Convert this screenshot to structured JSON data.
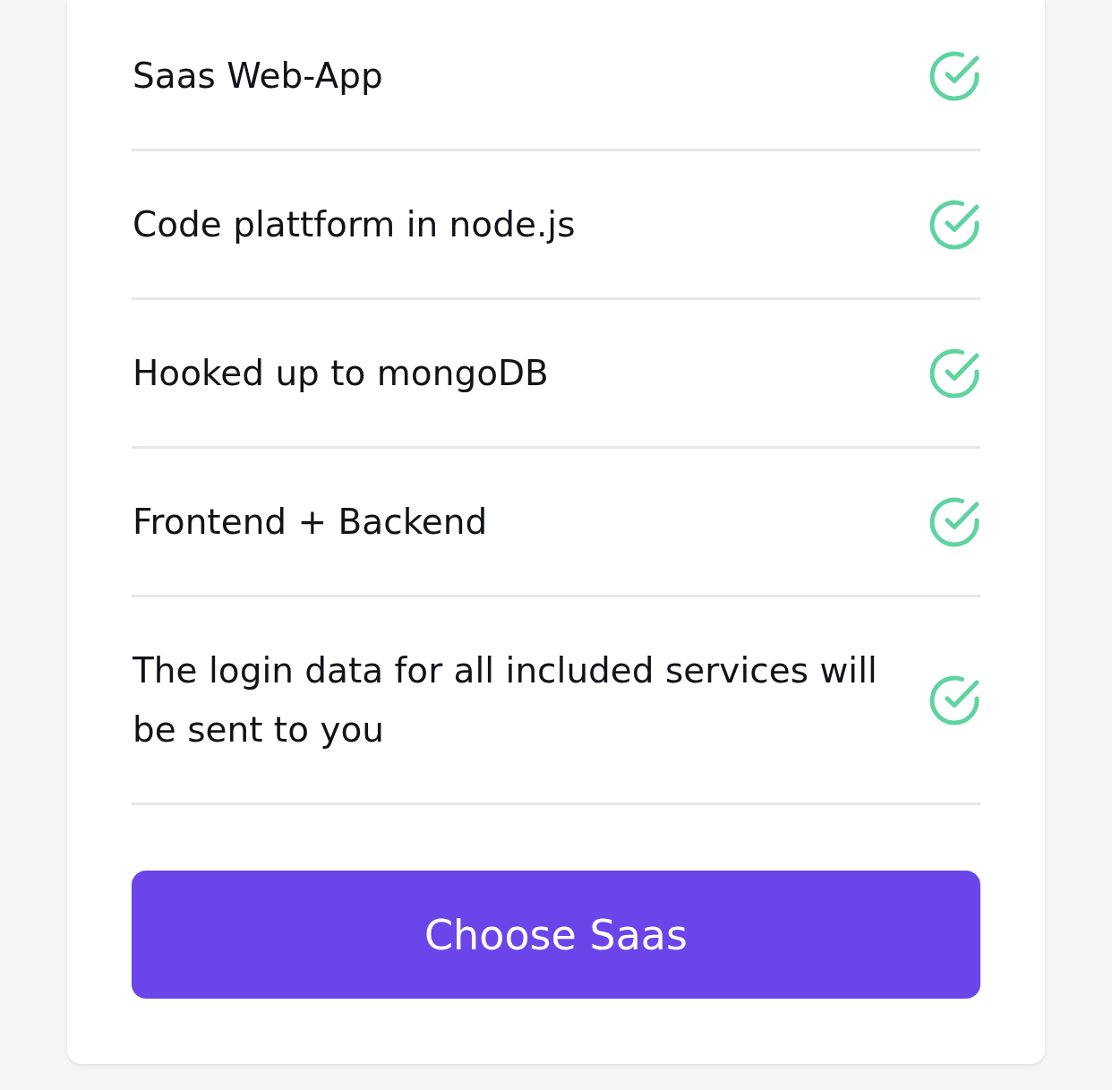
{
  "features": [
    {
      "text": "Saas Web-App",
      "included": true
    },
    {
      "text": "Code plattform in node.js",
      "included": true
    },
    {
      "text": "Hooked up to mongoDB",
      "included": true
    },
    {
      "text": "Frontend + Backend",
      "included": true
    },
    {
      "text": "The login data for all included services will be sent to you",
      "included": true
    }
  ],
  "button": {
    "label": "Choose Saas"
  }
}
